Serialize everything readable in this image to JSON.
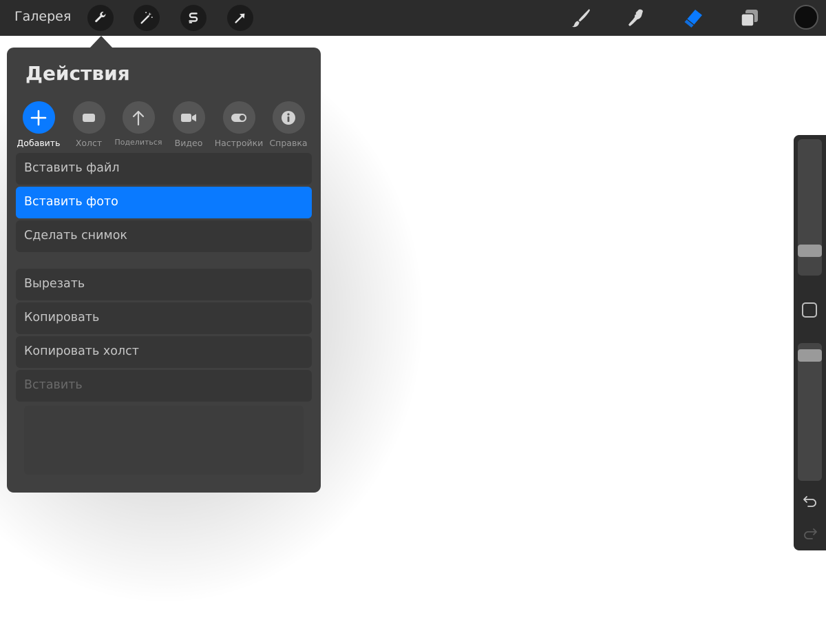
{
  "topbar": {
    "gallery_label": "Галерея",
    "left_tools": [
      {
        "name": "wrench-icon",
        "active": true
      },
      {
        "name": "magic-wand-icon",
        "active": false
      },
      {
        "name": "selection-s-icon",
        "active": false
      },
      {
        "name": "transform-arrow-icon",
        "active": false
      }
    ],
    "right_tools": [
      {
        "name": "brush-icon",
        "active": false
      },
      {
        "name": "smudge-icon",
        "active": false
      },
      {
        "name": "eraser-icon",
        "active": true
      },
      {
        "name": "layers-icon",
        "active": false
      }
    ],
    "current_color": "#0d0d0d",
    "accent_color": "#0a7aff"
  },
  "actions_panel": {
    "title": "Действия",
    "tabs": [
      {
        "label": "Добавить",
        "icon": "plus-icon",
        "active": true
      },
      {
        "label": "Холст",
        "icon": "canvas-icon",
        "active": false
      },
      {
        "label": "Поделиться",
        "icon": "share-arrow-icon",
        "active": false
      },
      {
        "label": "Видео",
        "icon": "video-camera-icon",
        "active": false
      },
      {
        "label": "Настройки",
        "icon": "toggle-icon",
        "active": false
      },
      {
        "label": "Справка",
        "icon": "info-icon",
        "active": false
      }
    ],
    "group1": [
      {
        "label": "Вставить файл",
        "selected": false,
        "disabled": false
      },
      {
        "label": "Вставить фото",
        "selected": true,
        "disabled": false
      },
      {
        "label": "Сделать снимок",
        "selected": false,
        "disabled": false
      }
    ],
    "group2": [
      {
        "label": "Вырезать",
        "selected": false,
        "disabled": false
      },
      {
        "label": "Копировать",
        "selected": false,
        "disabled": false
      },
      {
        "label": "Копировать холст",
        "selected": false,
        "disabled": false
      },
      {
        "label": "Вставить",
        "selected": false,
        "disabled": true
      }
    ]
  },
  "sidebar": {
    "brush_size_level": 0.15,
    "opacity_level": 0.95,
    "undo_icon": "undo-icon",
    "redo_icon": "redo-icon",
    "redo_enabled": false
  }
}
